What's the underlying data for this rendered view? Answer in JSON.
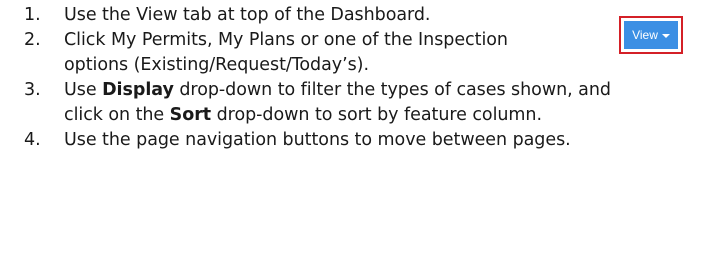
{
  "steps": [
    {
      "number": "1.",
      "text": "Use the View tab at top of the Dashboard."
    },
    {
      "number": "2.",
      "text": "Click My Permits, My Plans or one of the Inspection options (Existing/Request/Today’s)."
    },
    {
      "number": "3.",
      "part1": "Use ",
      "bold1": "Display",
      "part2": " drop-down to filter the types of cases shown, and click on the ",
      "bold2": "Sort",
      "part3": " drop-down to sort by feature column."
    },
    {
      "number": "4.",
      "text": "Use the page navigation buttons to move between pages."
    }
  ],
  "view_button": {
    "label": "View",
    "icon": "caret-down-icon",
    "background_color": "#3b8fe4",
    "highlight_color": "#d42027"
  }
}
